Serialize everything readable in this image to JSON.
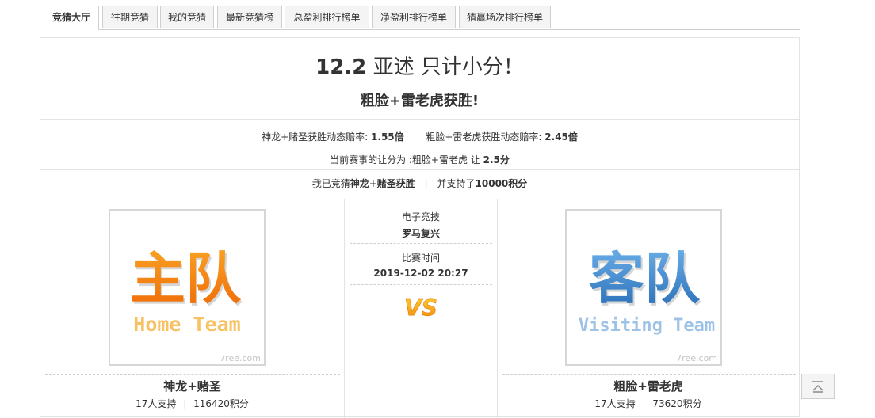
{
  "tabs": [
    {
      "label": "竞猜大厅",
      "active": true
    },
    {
      "label": "往期竞猜",
      "active": false
    },
    {
      "label": "我的竞猜",
      "active": false
    },
    {
      "label": "最新竞猜榜",
      "active": false
    },
    {
      "label": "总盈利排行榜单",
      "active": false
    },
    {
      "label": "净盈利排行榜单",
      "active": false
    },
    {
      "label": "猜赢场次排行榜单",
      "active": false
    }
  ],
  "match": {
    "title_date": "12.2",
    "title_rest": "亚述 只计小分！",
    "subtitle": "粗脸+雷老虎获胜!"
  },
  "odds": {
    "home_label": "神龙+赌圣获胜动态赔率:",
    "home_value": "1.55倍",
    "away_label": "粗脸+雷老虎获胜动态赔率:",
    "away_value": "2.45倍",
    "handicap_label": "当前赛事的让分为 :粗脸+雷老虎 让",
    "handicap_value": "2.5分"
  },
  "my_bet": {
    "prefix": "我已竞猜",
    "team": "神龙+赌圣获胜",
    "suffix": "并支持了",
    "points": "10000积分"
  },
  "home": {
    "logo_main": "主队",
    "logo_sub": "Home Team",
    "watermark": "7ree.com",
    "name": "神龙+赌圣",
    "supporters": "17人支持",
    "points": "116420积分",
    "colors": {
      "main": "#f47a0a",
      "sub": "#f8c264"
    }
  },
  "away": {
    "logo_main": "客队",
    "logo_sub": "Visiting Team",
    "watermark": "7ree.com",
    "name": "粗脸+雷老虎",
    "supporters": "17人支持",
    "points": "73620积分",
    "colors": {
      "main": "#3f86cf",
      "sub": "#9fc3e6"
    }
  },
  "center": {
    "category_label": "电子竞技",
    "category_value": "罗马复兴",
    "time_label": "比赛时间",
    "time_value": "2019-12-02 20:27",
    "vs": "VS"
  },
  "back_to_top_icon": "back-to-top-icon"
}
